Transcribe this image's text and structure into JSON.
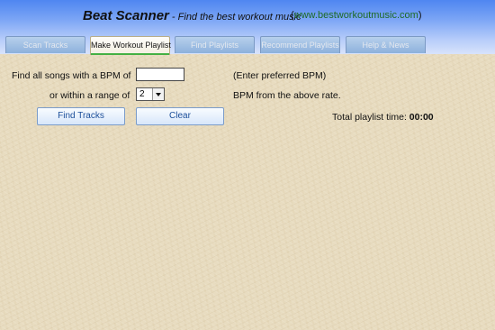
{
  "header": {
    "app_title": "Beat Scanner",
    "tagline": " - Find the best workout music",
    "site_open": "(",
    "site_url": "www.bestworkoutmusic.com",
    "site_close": ")"
  },
  "tabs": [
    {
      "label": "Scan Tracks",
      "active": false
    },
    {
      "label": "Make Workout Playlist",
      "active": true
    },
    {
      "label": "Find Playlists",
      "active": false
    },
    {
      "label": "Recommend Playlists",
      "active": false
    },
    {
      "label": "Help & News",
      "active": false
    }
  ],
  "form": {
    "bpm_label": "Find all songs with a BPM of",
    "bpm_value": "",
    "bpm_hint": "(Enter preferred BPM)",
    "range_label": "or within a range of",
    "range_value": "2",
    "range_hint": "BPM from the above rate.",
    "find_button": "Find Tracks",
    "clear_button": "Clear",
    "total_label": "Total playlist time: ",
    "total_value": "00:00"
  },
  "colors": {
    "header_top": "#4f86f1",
    "active_tab_underline": "#43b043",
    "link": "#1e6a25",
    "button_text": "#1c4f9a"
  }
}
